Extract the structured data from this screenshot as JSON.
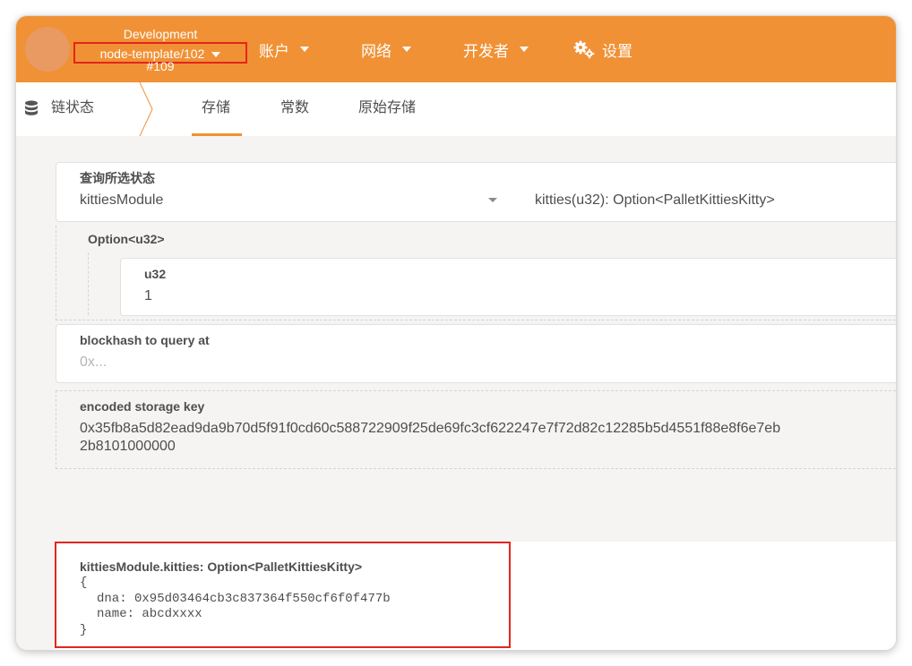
{
  "header": {
    "chain_env": "Development",
    "chain_node": "node-template/102",
    "chain_block": "#109",
    "menu": [
      {
        "label": "账户"
      },
      {
        "label": "网络"
      },
      {
        "label": "开发者"
      },
      {
        "label": "设置"
      }
    ],
    "brand_color": "#f19135"
  },
  "subnav": {
    "section": "链状态",
    "tabs": [
      {
        "label": "存储",
        "active": true
      },
      {
        "label": "常数"
      },
      {
        "label": "原始存储"
      }
    ]
  },
  "query": {
    "label": "查询所选状态",
    "module": "kittiesModule",
    "method": "kitties(u32): Option<PalletKittiesKitty>"
  },
  "param": {
    "option_label": "Option<u32>",
    "type_label": "u32",
    "value": "1"
  },
  "blockhash": {
    "label": "blockhash to query at",
    "placeholder": "0x..."
  },
  "storage_key": {
    "label": "encoded storage key",
    "line1": "0x35fb8a5d82ead9da9b70d5f91f0cd60c588722909f25de69fc3cf622247e7f72d82c12285b5d4551f88e8f6e7eb",
    "line2": "2b8101000000"
  },
  "result": {
    "title": "kittiesModule.kitties: Option<PalletKittiesKitty>",
    "open_brace": "{",
    "dna_line": "dna: 0x95d03464cb3c837364f550cf6f0f477b",
    "name_line": "name: abcdxxxx",
    "close_brace": "}"
  },
  "highlight_color": "#e3261b"
}
